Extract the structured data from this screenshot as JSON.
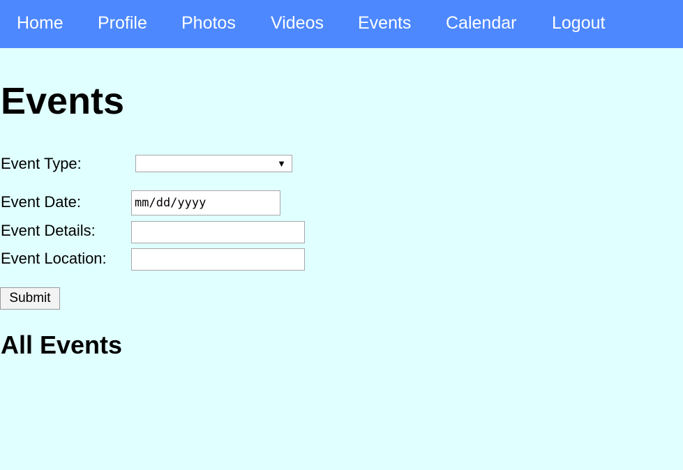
{
  "nav": {
    "items": [
      {
        "label": "Home"
      },
      {
        "label": "Profile"
      },
      {
        "label": "Photos"
      },
      {
        "label": "Videos"
      },
      {
        "label": "Events"
      },
      {
        "label": "Calendar"
      },
      {
        "label": "Logout"
      }
    ]
  },
  "page": {
    "title": "Events"
  },
  "form": {
    "event_type_label": "Event Type:",
    "event_type_value": "",
    "event_date_label": "Event Date:",
    "event_date_value": "mm/dd/yyyy",
    "event_details_label": "Event Details:",
    "event_details_value": "",
    "event_location_label": "Event Location:",
    "event_location_value": "",
    "submit_label": "Submit"
  },
  "all_events": {
    "title": "All Events"
  },
  "colors": {
    "nav_background": "#4d88ff",
    "page_background": "#e0ffff",
    "nav_text": "#ffffff"
  },
  "icons": {
    "select_arrow": "dropdown-arrow-icon"
  }
}
